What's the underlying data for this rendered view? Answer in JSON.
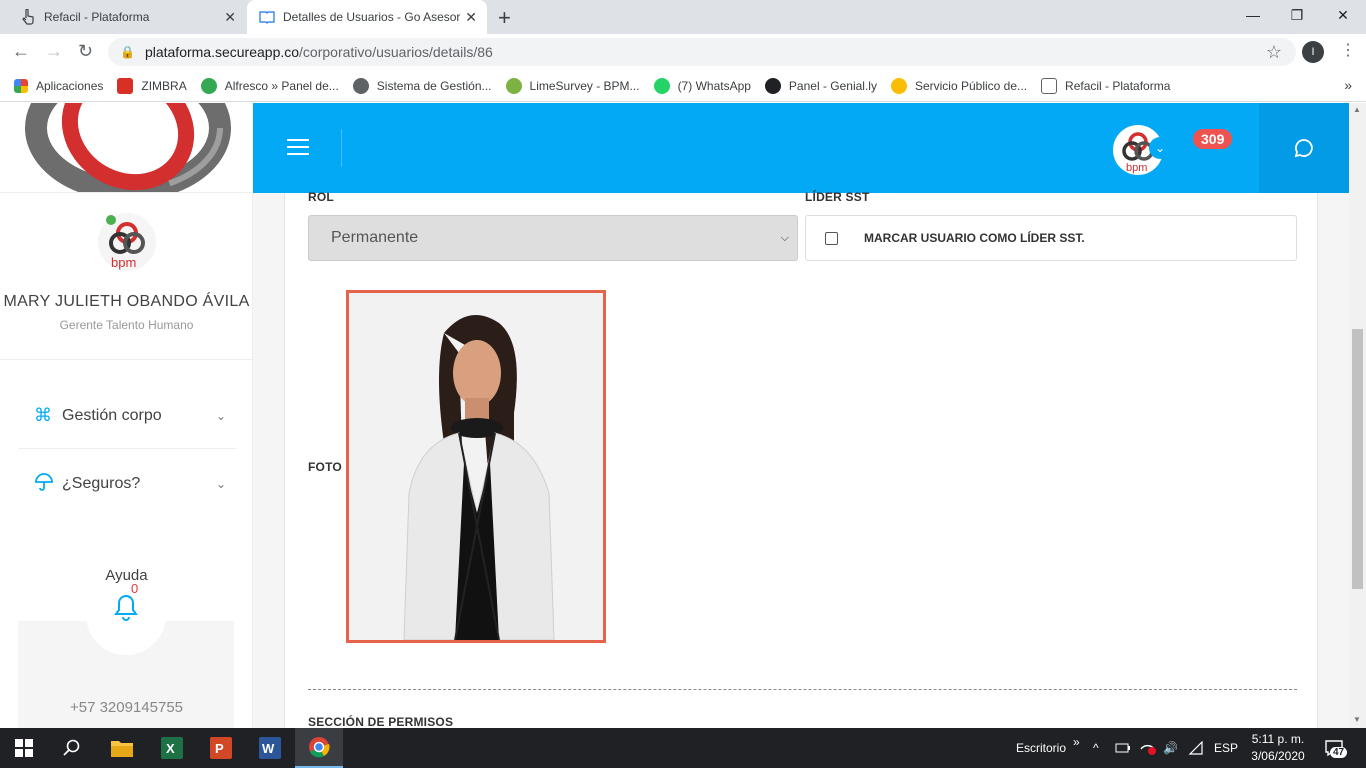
{
  "browser": {
    "tabs": [
      {
        "title": "Refacil - Plataforma"
      },
      {
        "title": "Detalles de Usuarios - Go Asesor"
      }
    ],
    "url_host": "plataforma.secureapp.co",
    "url_path": "/corporativo/usuarios/details/86",
    "profile_initial": "I",
    "bookmarks": [
      {
        "label": "Aplicaciones",
        "color": "#ea4335"
      },
      {
        "label": "ZIMBRA",
        "color": "#d93025"
      },
      {
        "label": "Alfresco » Panel de...",
        "color": "#34a853"
      },
      {
        "label": "Sistema de Gestión...",
        "color": "#5f6368"
      },
      {
        "label": "LimeSurvey - BPM...",
        "color": "#7cb342"
      },
      {
        "label": "(7) WhatsApp",
        "color": "#25d366"
      },
      {
        "label": "Panel - Genial.ly",
        "color": "#202124"
      },
      {
        "label": "Servicio Público de...",
        "color": "#fbbc04"
      },
      {
        "label": "Refacil - Plataforma",
        "color": "#5f6368"
      }
    ]
  },
  "topbar": {
    "notification_count": "309",
    "accent": "#03a9f4"
  },
  "sidebar": {
    "user_name": "MARY JULIETH OBANDO ÁVILA",
    "user_role": "Gerente Talento Humano",
    "avatar_text": "bpm",
    "menu": [
      {
        "label": "Gestión corpo",
        "icon": "command-icon"
      },
      {
        "label": "¿Seguros?",
        "icon": "umbrella-icon"
      }
    ],
    "help_label": "Ayuda",
    "help_count": "0",
    "phone": "+57 3209145755"
  },
  "form": {
    "rol_label": "ROL",
    "rol_value": "Permanente",
    "lider_label": "LÍDER SST",
    "lider_checkbox_label": "MARCAR USUARIO COMO LÍDER SST.",
    "lider_checked": false,
    "foto_label": "FOTO",
    "permisos_label": "SECCIÓN DE PERMISOS"
  },
  "taskbar": {
    "desktop_label": "Escritorio",
    "language": "ESP",
    "time": "5:11 p. m.",
    "date": "3/06/2020",
    "notifications": "47"
  }
}
